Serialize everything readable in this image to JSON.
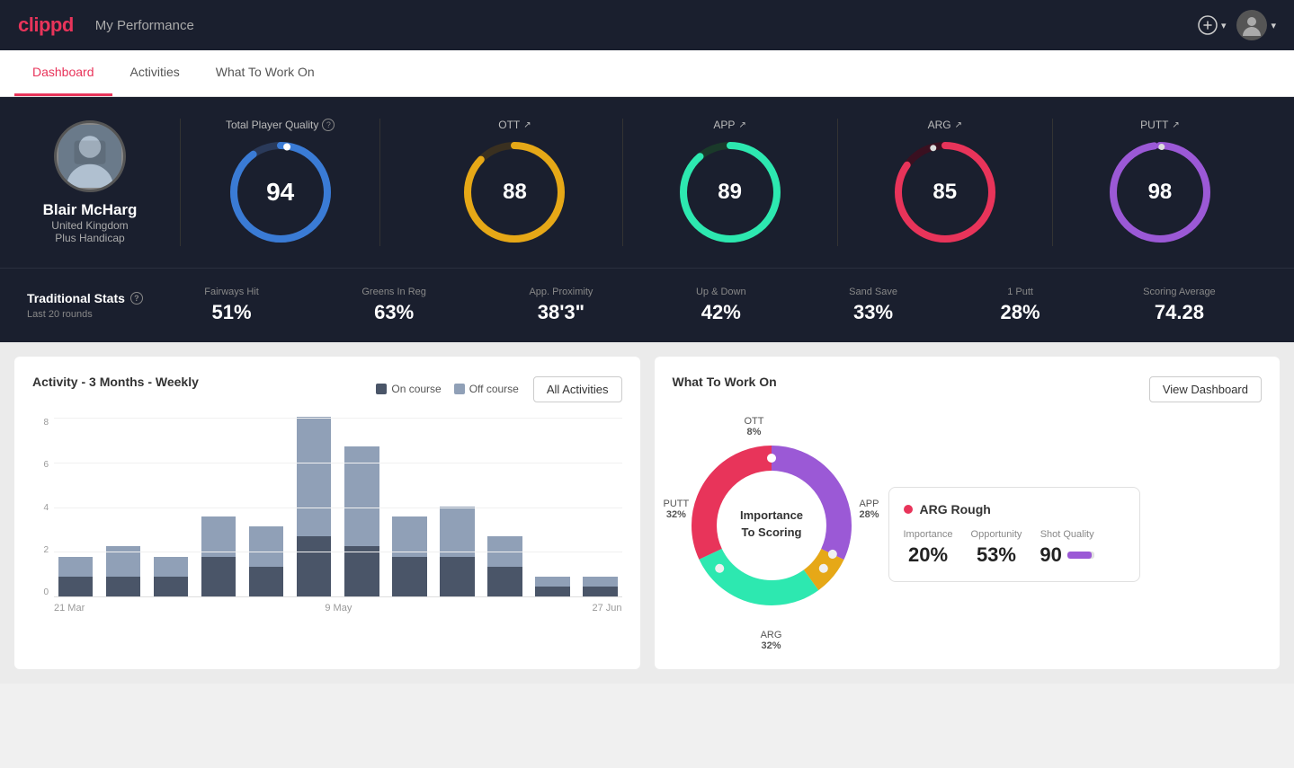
{
  "app": {
    "logo": "clippd",
    "nav_title": "My Performance",
    "tabs": [
      "Dashboard",
      "Activities",
      "What To Work On"
    ]
  },
  "player": {
    "name": "Blair McHarg",
    "country": "United Kingdom",
    "handicap": "Plus Handicap"
  },
  "total_quality": {
    "label": "Total Player Quality",
    "value": 94
  },
  "metrics": [
    {
      "label": "OTT",
      "value": 88,
      "color": "#e6a817",
      "trail": "#3a3a2a"
    },
    {
      "label": "APP",
      "value": 89,
      "color": "#2de8b0",
      "trail": "#1a3a2a"
    },
    {
      "label": "ARG",
      "value": 85,
      "color": "#e8345a",
      "trail": "#3a1a2a"
    },
    {
      "label": "PUTT",
      "value": 98,
      "color": "#9b59d6",
      "trail": "#2a1a3a"
    }
  ],
  "trad_stats": {
    "title": "Traditional Stats",
    "subtitle": "Last 20 rounds",
    "items": [
      {
        "label": "Fairways Hit",
        "value": "51%"
      },
      {
        "label": "Greens In Reg",
        "value": "63%"
      },
      {
        "label": "App. Proximity",
        "value": "38'3\""
      },
      {
        "label": "Up & Down",
        "value": "42%"
      },
      {
        "label": "Sand Save",
        "value": "33%"
      },
      {
        "label": "1 Putt",
        "value": "28%"
      },
      {
        "label": "Scoring Average",
        "value": "74.28"
      }
    ]
  },
  "chart": {
    "title": "Activity - 3 Months - Weekly",
    "legend_on": "On course",
    "legend_off": "Off course",
    "all_activities_btn": "All Activities",
    "x_labels": [
      "21 Mar",
      "9 May",
      "27 Jun"
    ],
    "y_labels": [
      "0",
      "2",
      "4",
      "6",
      "8"
    ],
    "bars": [
      {
        "on": 1,
        "off": 1
      },
      {
        "on": 1,
        "off": 1.5
      },
      {
        "on": 1,
        "off": 1
      },
      {
        "on": 2,
        "off": 2
      },
      {
        "on": 1.5,
        "off": 2
      },
      {
        "on": 3,
        "off": 6
      },
      {
        "on": 2.5,
        "off": 5
      },
      {
        "on": 2,
        "off": 2
      },
      {
        "on": 2,
        "off": 2.5
      },
      {
        "on": 1.5,
        "off": 1.5
      },
      {
        "on": 0.5,
        "off": 0.5
      },
      {
        "on": 0.5,
        "off": 0.5
      }
    ]
  },
  "wtw": {
    "title": "What To Work On",
    "view_btn": "View Dashboard",
    "donut_center": "Importance\nTo Scoring",
    "segments": [
      {
        "label": "OTT",
        "value": "8%",
        "color": "#e6a817",
        "degrees": 28
      },
      {
        "label": "APP",
        "value": "28%",
        "color": "#2de8b0",
        "degrees": 101
      },
      {
        "label": "ARG",
        "value": "32%",
        "color": "#e8345a",
        "degrees": 115
      },
      {
        "label": "PUTT",
        "value": "32%",
        "color": "#9b59d6",
        "degrees": 116
      }
    ],
    "card": {
      "title": "ARG Rough",
      "importance": "20%",
      "opportunity": "53%",
      "shot_quality": "90"
    }
  }
}
